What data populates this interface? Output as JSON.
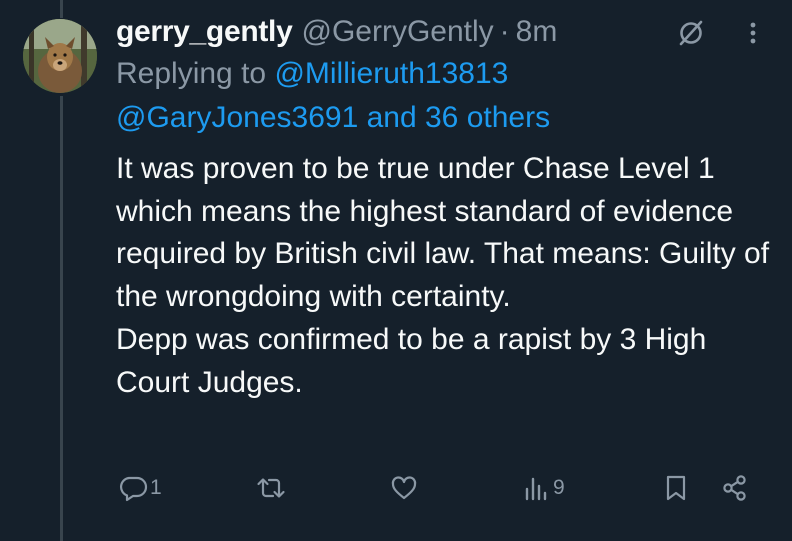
{
  "tweet": {
    "display_name": "gerry_gently",
    "handle": "@GerryGently",
    "separator": "·",
    "time": "8m",
    "replying_prefix": "Replying to ",
    "mention_1": "@Millieruth13813",
    "mention_2": "@GaryJones3691",
    "and_text": " and ",
    "others_text": "36 others",
    "body_lines": [
      "It was proven to be true under Chase Level 1 which means the highest standard of evidence required by British civil law. That means: Guilty of the wrongdoing with certainty.",
      "Depp was confirmed to be a rapist by 3 High Court Judges."
    ]
  },
  "actions": {
    "reply_count": "1",
    "retweet_count": "",
    "like_count": "",
    "views_count": "9"
  },
  "colors": {
    "background": "#15202b",
    "text": "#f7f9f9",
    "muted": "#8b98a5",
    "link": "#1d9bf0"
  },
  "icons": [
    "grok-icon",
    "more-icon",
    "reply-icon",
    "retweet-icon",
    "like-icon",
    "views-icon",
    "bookmark-icon",
    "share-icon"
  ]
}
